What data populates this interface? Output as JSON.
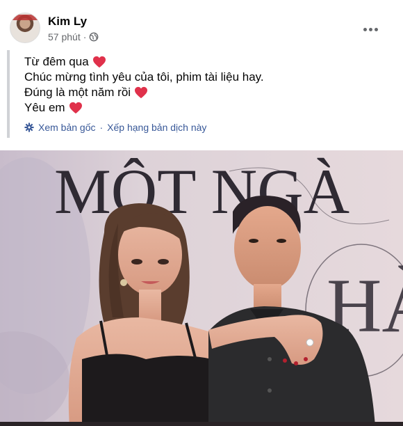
{
  "post": {
    "author": "Kim Ly",
    "time": "57 phút",
    "lines": [
      {
        "text": "Từ đêm qua",
        "heart": true
      },
      {
        "text": "Chúc mừng tình yêu của tôi, phim tài liệu hay.",
        "heart": false
      },
      {
        "text": "Đúng là một năm rồi",
        "heart": true
      },
      {
        "text": "Yêu em",
        "heart": true
      }
    ],
    "translate": {
      "see_original": "Xem bản gốc",
      "separator": "·",
      "rate": "Xếp hạng bản dịch này"
    }
  },
  "photo": {
    "backdrop_title": "MỘT NGÀ",
    "backdrop_sub": "HÀ"
  },
  "colors": {
    "link": "#385898",
    "heart": "#e0314b",
    "meta": "#65676b"
  }
}
